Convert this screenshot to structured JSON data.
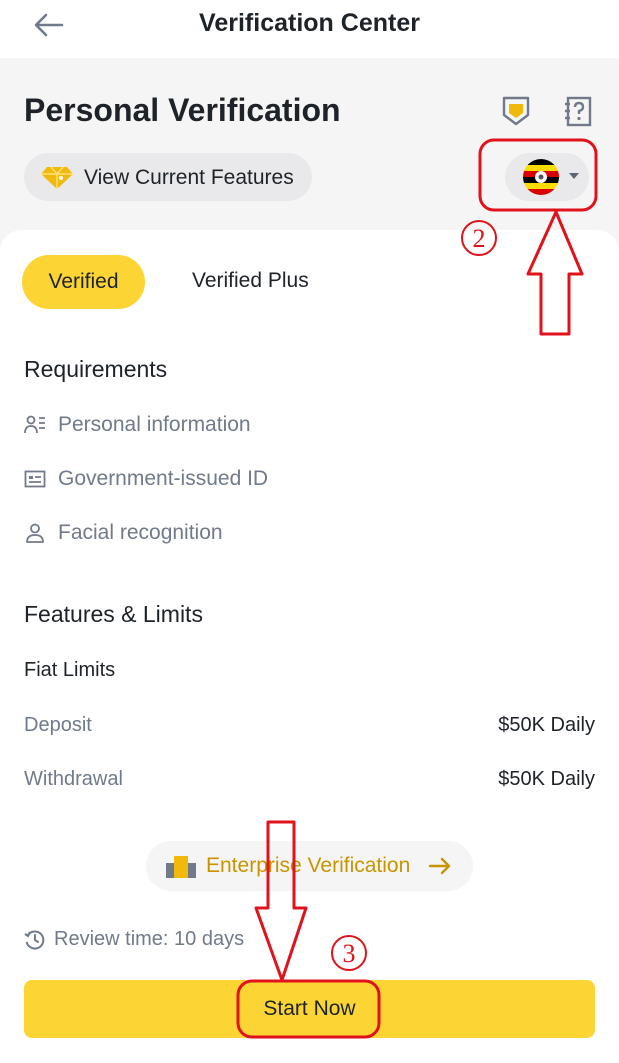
{
  "topbar": {
    "title": "Verification Center",
    "back_icon": "arrow-left-icon"
  },
  "header": {
    "title": "Personal Verification",
    "features_label": "View Current Features",
    "country_flag": "uganda-flag-icon"
  },
  "tabs": [
    {
      "label": "Verified",
      "active": true
    },
    {
      "label": "Verified Plus",
      "active": false
    }
  ],
  "requirements": {
    "title": "Requirements",
    "items": [
      {
        "label": "Personal information",
        "icon": "person-info-icon"
      },
      {
        "label": "Government-issued ID",
        "icon": "id-card-icon"
      },
      {
        "label": "Facial recognition",
        "icon": "person-icon"
      }
    ]
  },
  "features": {
    "title": "Features & Limits",
    "fiat_title": "Fiat Limits",
    "rows": [
      {
        "label": "Deposit",
        "value": "$50K Daily"
      },
      {
        "label": "Withdrawal",
        "value": "$50K Daily"
      }
    ]
  },
  "enterprise": {
    "label": "Enterprise Verification"
  },
  "review": {
    "text": "Review time: 10 days"
  },
  "start_button": {
    "label": "Start Now"
  },
  "annotations": {
    "step2": "2",
    "step3": "3"
  },
  "colors": {
    "accent": "#fcd535",
    "enterprise_text": "#c99400",
    "annotation_red": "#e0121b",
    "muted_text": "#707a8a"
  }
}
